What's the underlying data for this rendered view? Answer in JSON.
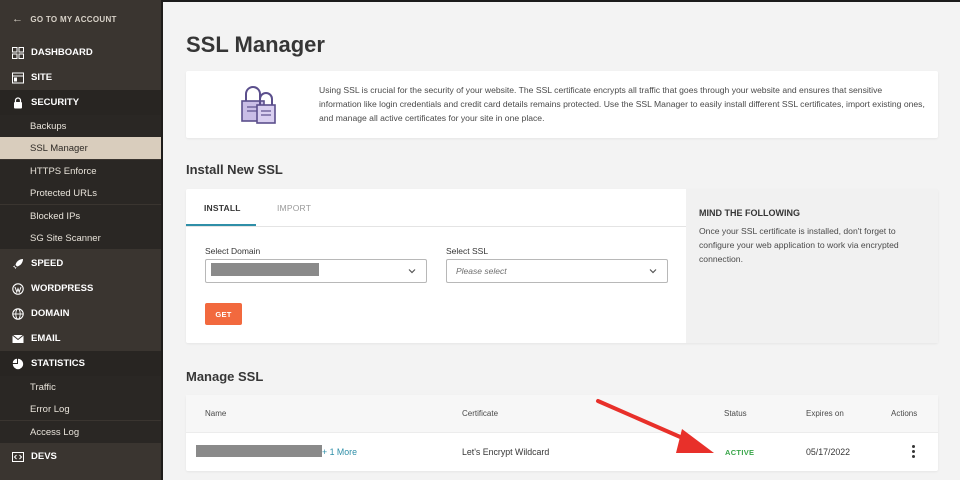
{
  "sidebar": {
    "back_label": "GO TO MY ACCOUNT",
    "sections": {
      "dashboard": "DASHBOARD",
      "site": "SITE",
      "security": "SECURITY",
      "speed": "SPEED",
      "wordpress": "WORDPRESS",
      "domain": "DOMAIN",
      "email": "EMAIL",
      "statistics": "STATISTICS",
      "devs": "DEVS"
    },
    "security_items": [
      "Backups",
      "SSL Manager",
      "HTTPS Enforce",
      "Protected URLs",
      "Blocked IPs",
      "SG Site Scanner"
    ],
    "statistics_items": [
      "Traffic",
      "Error Log",
      "Access Log"
    ],
    "active_item": "SSL Manager"
  },
  "page": {
    "title": "SSL Manager",
    "intro": "Using SSL is crucial for the security of your website. The SSL certificate encrypts all traffic that goes through your website and ensures that sensitive information like login credentials and credit card details remains protected. Use the SSL Manager to easily install different SSL certificates, import existing ones, and manage all active certificates for your site in one place."
  },
  "install": {
    "section_title": "Install New SSL",
    "tabs": [
      "INSTALL",
      "IMPORT"
    ],
    "active_tab": "INSTALL",
    "domain_label": "Select Domain",
    "ssl_label": "Select SSL",
    "ssl_placeholder": "Please select",
    "get_label": "GET",
    "mind_title": "MIND THE FOLLOWING",
    "mind_text": "Once your SSL certificate is installed, don't forget to configure your web application to work via encrypted connection."
  },
  "manage": {
    "section_title": "Manage SSL",
    "columns": [
      "Name",
      "Certificate",
      "Status",
      "Expires on",
      "Actions"
    ],
    "rows": [
      {
        "more": "+ 1 More",
        "certificate": "Let's Encrypt Wildcard",
        "status": "ACTIVE",
        "expires": "05/17/2022"
      }
    ]
  },
  "colors": {
    "sidebar_bg": "#3a3530",
    "active_item_bg": "#d9cdbd",
    "accent_teal": "#2f8fa8",
    "button_orange": "#f2693e",
    "status_green": "#3aa64a",
    "annotation_red": "#e8302a"
  }
}
